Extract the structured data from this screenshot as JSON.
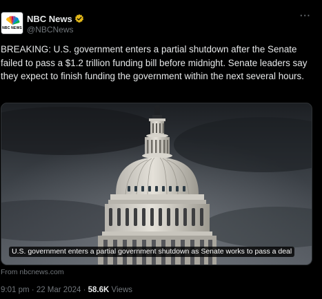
{
  "author": {
    "display_name": "NBC News",
    "handle": "@NBCNews",
    "avatar_label": "NBC NEWS",
    "verified_badge": "gold-verified-badge-icon",
    "more_label": "···"
  },
  "tweet": {
    "text": "BREAKING: U.S. government enters a partial shutdown after the Senate failed to pass a $1.2 trillion funding bill before midnight. Senate leaders say they expect to finish funding the government within the next several hours."
  },
  "media": {
    "description": "photo-capitol-dome-dark-clouds",
    "caption": "U.S. government enters a partial government shutdown as Senate works to pass a deal",
    "source": "From nbcnews.com"
  },
  "meta": {
    "time": "9:01 pm",
    "separator": "·",
    "date": "22 Mar 2024",
    "views_count": "58.6K",
    "views_label": "Views"
  },
  "colors": {
    "background": "#000000",
    "text_primary": "#e7e9ea",
    "text_secondary": "#71767b",
    "verified_gold": "#e2b719"
  }
}
